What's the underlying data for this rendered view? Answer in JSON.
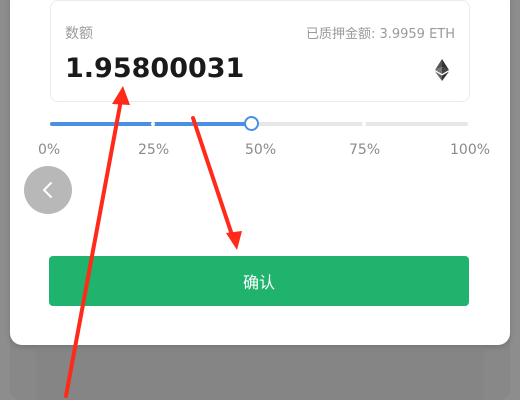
{
  "form": {
    "amount_label": "数额",
    "staked_info": "已质押金额: 3.9959 ETH",
    "amount_value": "1.95800031",
    "currency_icon": "ethereum-icon"
  },
  "slider": {
    "value_fraction": 0.5,
    "labels": [
      "0%",
      "25%",
      "50%",
      "75%",
      "100%"
    ]
  },
  "actions": {
    "confirm_label": "确认",
    "back_icon": "chevron-left-icon"
  },
  "colors": {
    "accent": "#4a90e2",
    "confirm": "#1fb36d",
    "annotation": "#ff2a1a"
  }
}
